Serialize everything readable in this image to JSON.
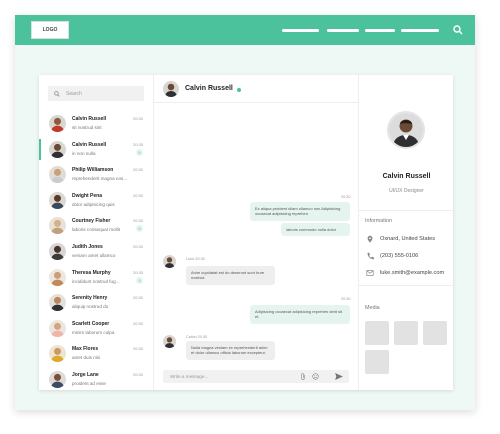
{
  "site": {
    "logo": "LOGO"
  },
  "sidebar": {
    "search_placeholder": "Search",
    "contacts": [
      {
        "name": "Calvin Russell",
        "preview": "sit nostrud sint",
        "time": "20:30",
        "badge": ""
      },
      {
        "name": "Calvin Russell",
        "preview": "in non nulla",
        "time": "20:30",
        "badge": "5"
      },
      {
        "name": "Philip Williamson",
        "preview": "reprehenderit magna nos...",
        "time": "20:30",
        "badge": ""
      },
      {
        "name": "Dwight Pena",
        "preview": "dolor adipisicing quis",
        "time": "20:30",
        "badge": ""
      },
      {
        "name": "Courtney Fisher",
        "preview": "laboris consequat mollit",
        "time": "20:30",
        "badge": "5"
      },
      {
        "name": "Judith Jones",
        "preview": "veniam amet ullamco",
        "time": "20:30",
        "badge": ""
      },
      {
        "name": "Theresa Murphy",
        "preview": "incididunt nostrud fug...",
        "time": "20:30",
        "badge": "3"
      },
      {
        "name": "Serenity Henry",
        "preview": "aliquip nostrud do",
        "time": "20:30",
        "badge": ""
      },
      {
        "name": "Scarlett Cooper",
        "preview": "minim laborum culpa",
        "time": "20:30",
        "badge": ""
      },
      {
        "name": "Max Flores",
        "preview": "amet duis nisi",
        "time": "20:30",
        "badge": ""
      },
      {
        "name": "Jorge Lane",
        "preview": "proident ad esse",
        "time": "20:30",
        "badge": ""
      }
    ]
  },
  "chat": {
    "header_name": "Calvin Russell",
    "messages": [
      {
        "dir": "out",
        "meta": "20:30",
        "text": "Ex aliqua proident ullam ullamco non Adipisicing occaecat adipisicing reprehen"
      },
      {
        "dir": "out",
        "meta": "",
        "text": "laboris commodo nulla dolor"
      },
      {
        "dir": "in",
        "meta": "Luke 20:30",
        "text": "Anim cupidatat est do deserunt sunt Irure nostrud."
      },
      {
        "dir": "out",
        "meta": "20:30",
        "text": "Adipisicing occaecat adipisicing reprehen derit sit et."
      },
      {
        "dir": "in",
        "meta": "Calvin 20:30",
        "text": "Nulla magna veniam ex reprehenderit anim et dolor ullamco officia laborum excepteur."
      }
    ],
    "compose_placeholder": "Write a message..."
  },
  "details": {
    "name": "Calvin Russell",
    "role": "UI/UX Designer",
    "info_title": "Information",
    "location": "Oxnard, United States",
    "phone": "(203) 555-0106",
    "email": "luke.smith@example.com",
    "media_title": "Media"
  },
  "colors": {
    "accent": "#4cc29c",
    "outgoing_bubble": "#e5f4ef",
    "incoming_bubble": "#eeeeee"
  }
}
